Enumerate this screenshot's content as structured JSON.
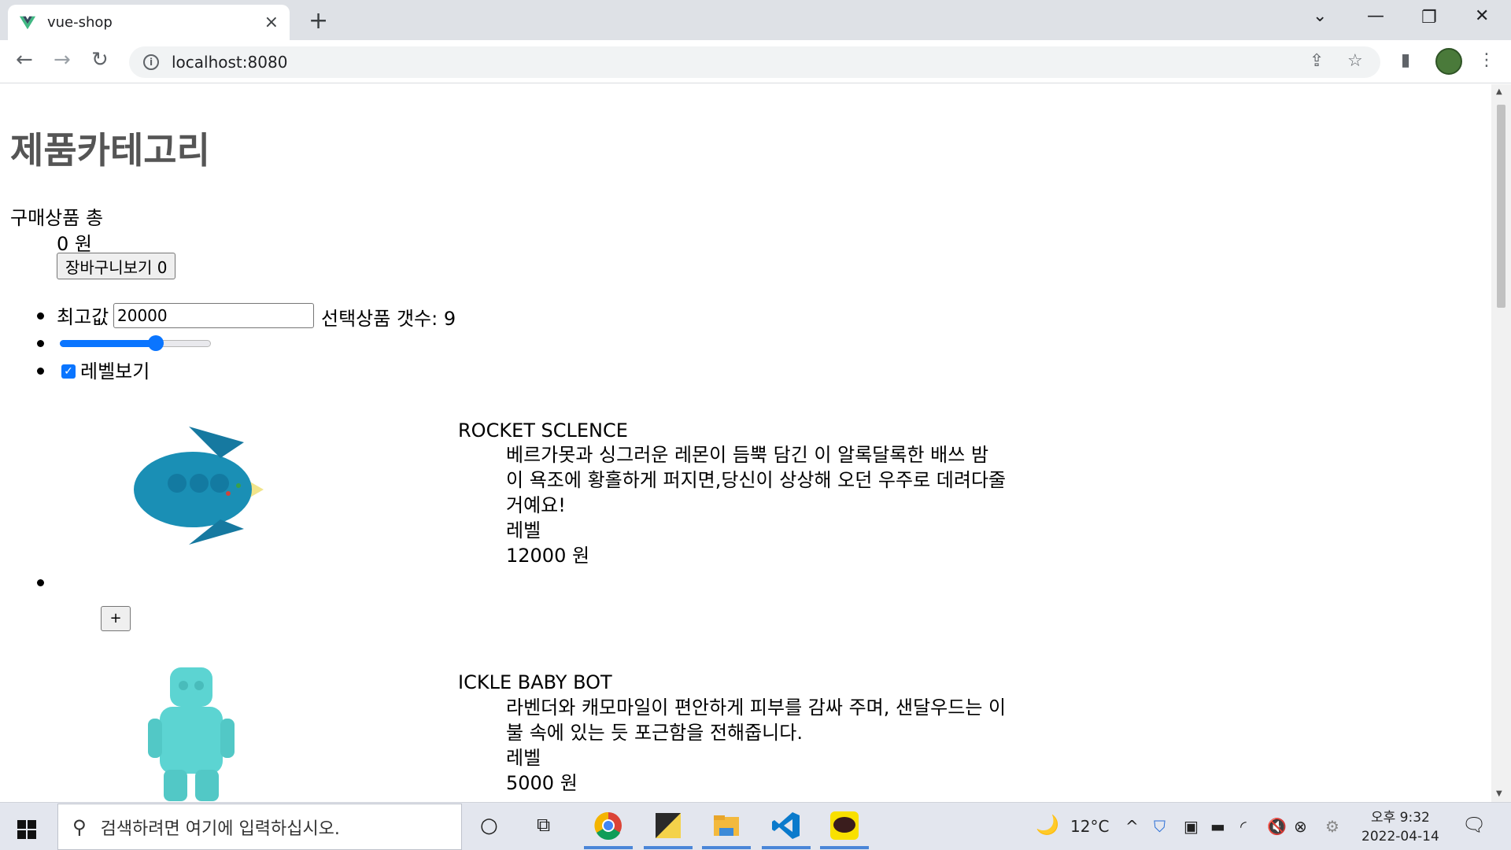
{
  "browser": {
    "tab_title": "vue-shop",
    "tab_close": "×",
    "new_tab": "+",
    "url": "localhost:8080",
    "info_glyph": "i"
  },
  "page": {
    "title": "제품카테고리",
    "cart_label": "구매상품 총",
    "cart_total": "0 원",
    "view_cart_button": "장바구니보기 0",
    "max_price_label": "최고값",
    "max_price_value": "20000",
    "selected_count": "선택상품 갯수: 9",
    "slider_fraction": 0.65,
    "show_label_checkbox": "레벨보기",
    "show_label_checked": true
  },
  "products": [
    {
      "name": "ROCKET SCLENCE",
      "description_line1": "베르가못과 싱그러운 레몬이 듬뿍 담긴 이 알록달록한 배쓰 밤",
      "description_line2": "이 욕조에 황홀하게 퍼지면,당신이 상상해 오던 우주로 데려다줄",
      "description_line3": "거예요!",
      "label": "레벨",
      "price": "12000 원",
      "add_button": "+"
    },
    {
      "name": "ICKLE BABY BOT",
      "description_line1": "라벤더와 캐모마일이 편안하게 피부를 감싸 주며, 샌달우드는 이",
      "description_line2": "불 속에 있는 듯 포근함을 전해줍니다.",
      "label": "레벨",
      "price": "5000 원"
    }
  ],
  "taskbar": {
    "search_placeholder": "검색하려면 여기에 입력하십시오.",
    "weather": "12°C",
    "time": "오후 9:32",
    "date": "2022-04-14"
  },
  "colors": {
    "accent": "#0a75ff",
    "title_gray": "#555555",
    "chrome_bg": "#dee1e6"
  }
}
